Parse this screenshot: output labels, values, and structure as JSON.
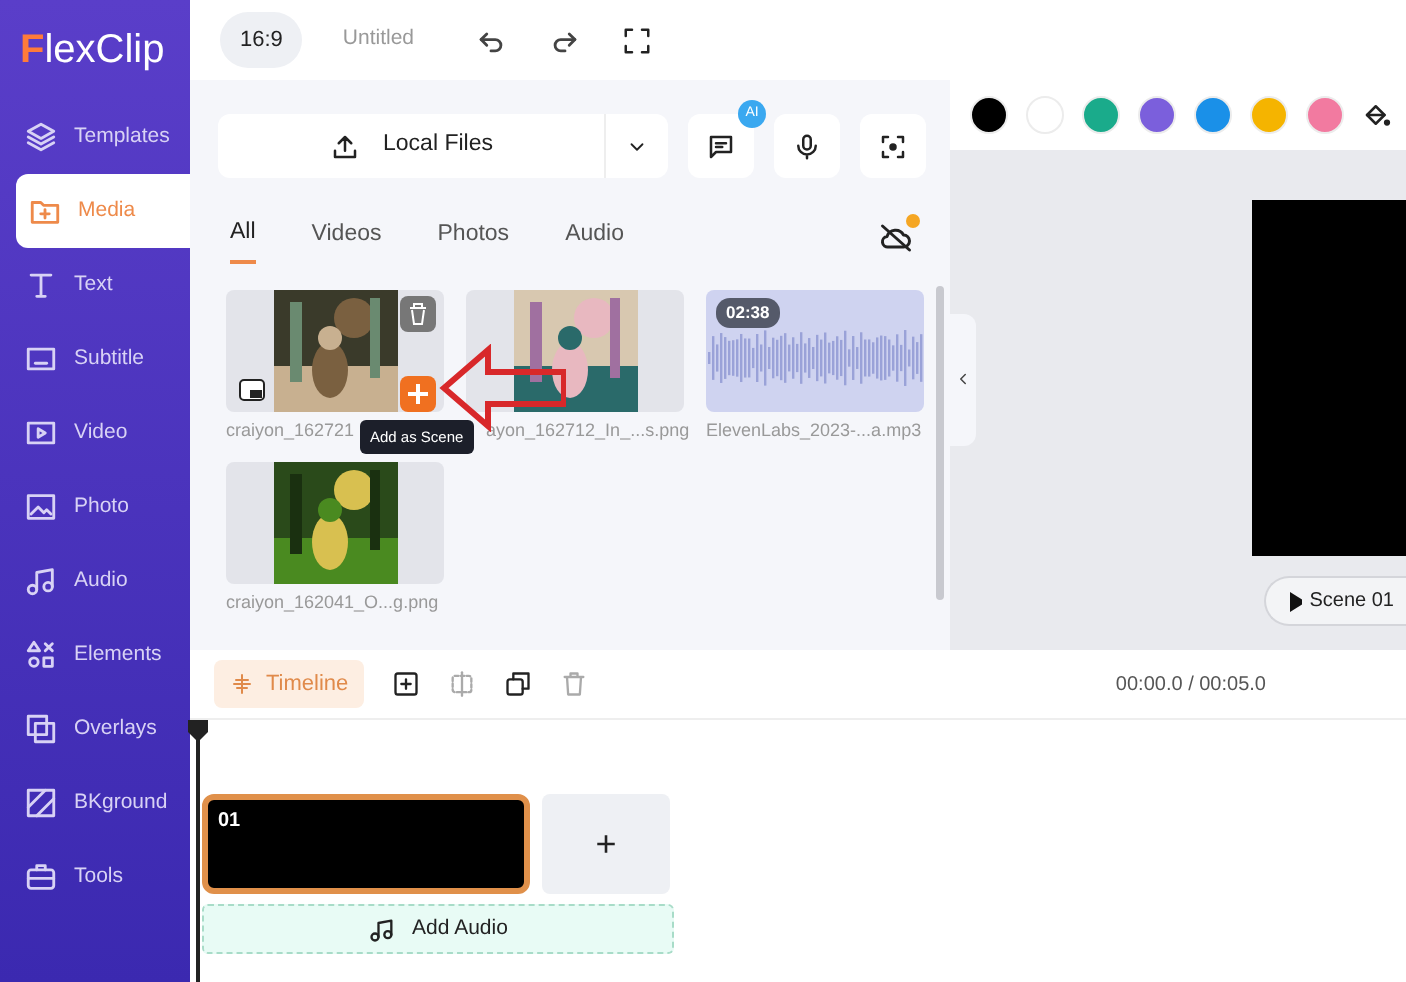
{
  "logo": {
    "mark": "F",
    "rest": "lexClip"
  },
  "sidebar": {
    "items": [
      {
        "label": "Templates",
        "selected": false
      },
      {
        "label": "Media",
        "selected": true
      },
      {
        "label": "Text",
        "selected": false
      },
      {
        "label": "Subtitle",
        "selected": false
      },
      {
        "label": "Video",
        "selected": false
      },
      {
        "label": "Photo",
        "selected": false
      },
      {
        "label": "Audio",
        "selected": false
      },
      {
        "label": "Elements",
        "selected": false
      },
      {
        "label": "Overlays",
        "selected": false
      },
      {
        "label": "BKground",
        "selected": false
      },
      {
        "label": "Tools",
        "selected": false
      }
    ]
  },
  "toolbar": {
    "aspect": "16:9",
    "title": "Untitled"
  },
  "media": {
    "upload_button": "Local Files",
    "ai_badge": "AI",
    "tabs": [
      {
        "label": "All",
        "selected": true
      },
      {
        "label": "Videos",
        "selected": false
      },
      {
        "label": "Photos",
        "selected": false
      },
      {
        "label": "Audio",
        "selected": false
      }
    ],
    "items": [
      {
        "filename": "craiyon_162721"
      },
      {
        "filename": "ayon_162712_In_...s.png"
      },
      {
        "kind": "audio",
        "duration": "02:38",
        "filename": "ElevenLabs_2023-...a.mp3"
      },
      {
        "filename": "craiyon_162041_O...g.png"
      }
    ],
    "tooltip": "Add as Scene"
  },
  "palette": {
    "colors": [
      {
        "color": "#000000"
      },
      {
        "color": "#ffffff"
      },
      {
        "color": "#1aab8b"
      },
      {
        "color": "#7b5fdc"
      },
      {
        "color": "#1a90e8"
      },
      {
        "color": "#f5b400"
      },
      {
        "color": "#f27aa0"
      }
    ]
  },
  "preview": {
    "scene_button": "Scene 01"
  },
  "timeline": {
    "label": "Timeline",
    "time": "00:00.0 / 00:05.0",
    "clips": [
      {
        "number": "01",
        "selected": true
      }
    ],
    "add_scene": "+",
    "add_audio": "Add Audio"
  }
}
